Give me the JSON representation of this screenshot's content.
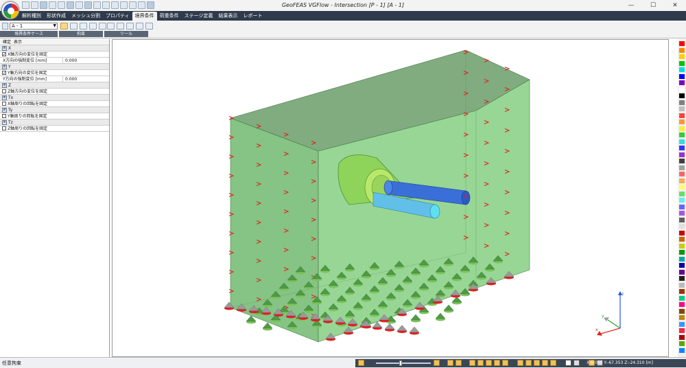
{
  "app": {
    "title": "GeoFEAS VGFlow - Intersection [P - 1] [A - 1]",
    "window_controls": [
      "—",
      "☐",
      "✕"
    ]
  },
  "menu": {
    "tabs": [
      "解析種別",
      "形状作成",
      "メッシュ分割",
      "プロパティ",
      "境界条件",
      "荷重条件",
      "ステージ定義",
      "結果表示",
      "レポート"
    ],
    "active_index": 4
  },
  "ribbon": {
    "case_value": "A - 1",
    "group_labels": [
      "境界条件ケース",
      "拘束",
      "ツール"
    ]
  },
  "panel": {
    "tabs": [
      "確定",
      "表示"
    ],
    "x_group": "X",
    "x_fix": "X軸方向の変位を固定",
    "x_disp_label": "X方向の強制変位 [mm]",
    "x_disp_value": "0.000",
    "y_group": "Y",
    "y_fix": "Y軸方向の変位を固定",
    "y_disp_label": "Y方向の強制変位 [mm]",
    "y_disp_value": "0.000",
    "z_group": "Z",
    "z_fix": "Z軸方向の変位を固定",
    "tx_group": "Tx",
    "tx_fix": "X軸周りの回転を固定",
    "ty_group": "Ty",
    "ty_fix": "Y軸周りの回転を固定",
    "tz_group": "Tz",
    "tz_fix": "Z軸周りの回転を固定"
  },
  "axes": {
    "x": "x",
    "y": "y",
    "z": "z"
  },
  "status": {
    "left_text": "任意拘束",
    "coords": "X:0.000 Y:-67.353 Z:-24.310 [m]"
  },
  "colors": {
    "accent_tab": "#2f3b4c",
    "mesh_green": "#6cc46c",
    "support_red": "#e02020",
    "pipe_blue": "#3a6fd8",
    "palette": [
      "#ff0000",
      "#ff8800",
      "#ffd000",
      "#00c000",
      "#00e0e0",
      "#0000ff",
      "#8000c0",
      "#ffffff",
      "#000000",
      "#808080",
      "#c0c0c0",
      "#ff4040",
      "#ff9933",
      "#ffee33",
      "#33cc33",
      "#33dddd",
      "#3333ff",
      "#9933cc",
      "#404040",
      "#a0a0a0",
      "#ff6666",
      "#ffaa55",
      "#ffff66",
      "#66dd66",
      "#66eeee",
      "#6666ff",
      "#aa55dd",
      "#606060",
      "#e0e0e0",
      "#cc0000",
      "#cc6600",
      "#cccc00",
      "#009900",
      "#00aaaa",
      "#0000aa",
      "#660099",
      "#202020",
      "#bbbbbb",
      "#993300",
      "#00cc88",
      "#ff0088",
      "#884400",
      "#bb8800",
      "#3399ff",
      "#ff2244",
      "#aa0000",
      "#55aa00",
      "#0088ff"
    ]
  }
}
